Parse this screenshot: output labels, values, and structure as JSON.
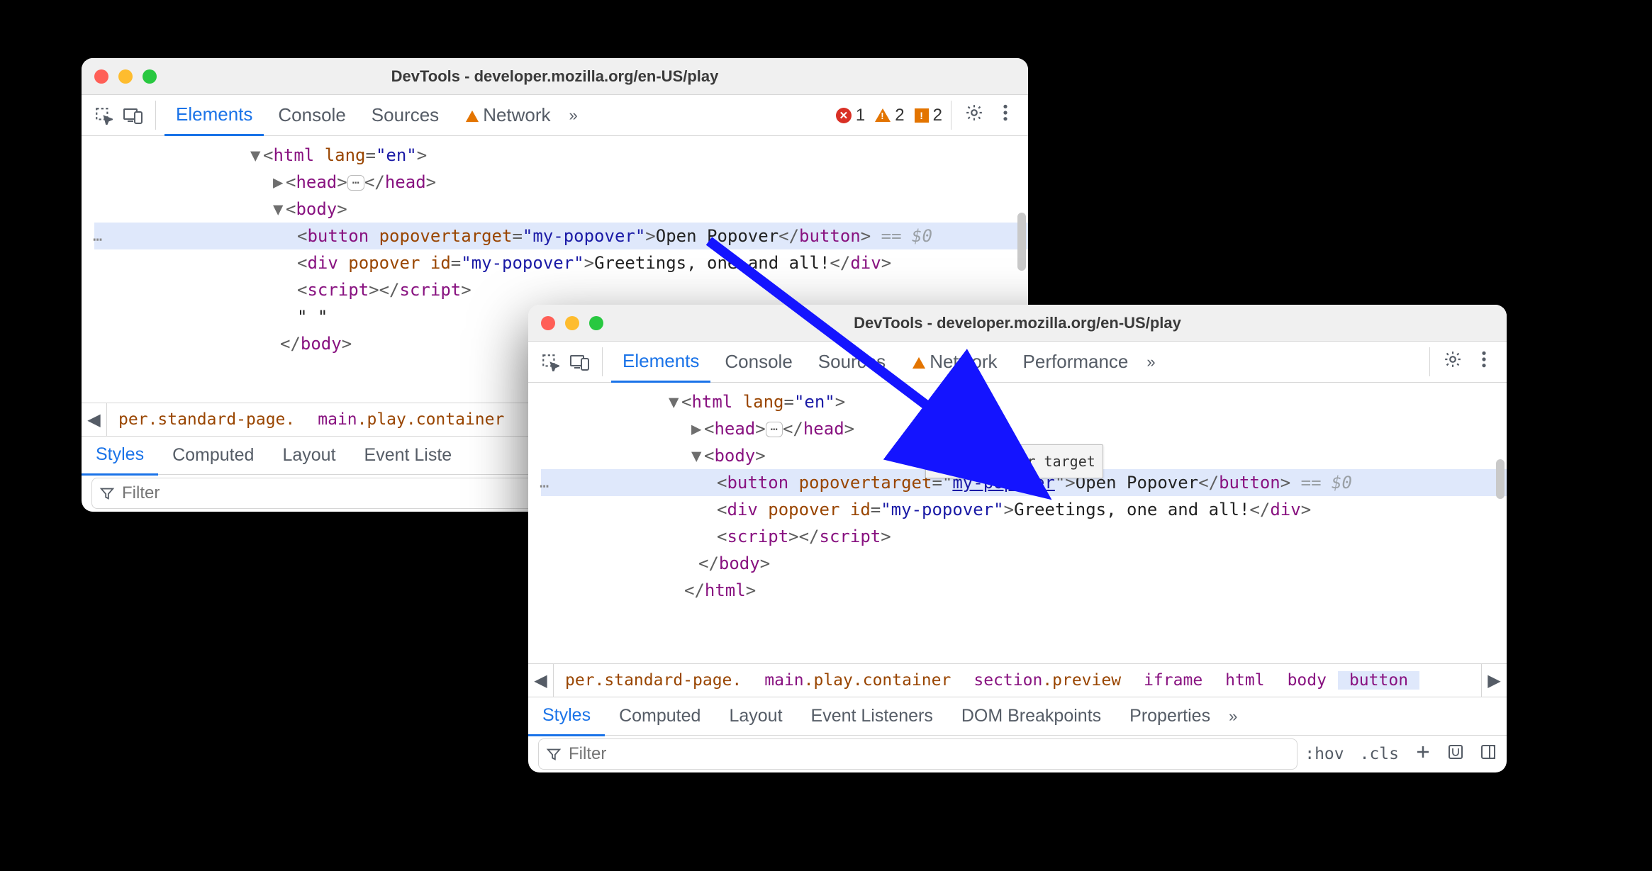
{
  "windowA": {
    "title": "DevTools - developer.mozilla.org/en-US/play",
    "tabs": {
      "elements": "Elements",
      "console": "Console",
      "sources": "Sources",
      "network": "Network"
    },
    "overflow": "»",
    "counts": {
      "error": "1",
      "warning": "2",
      "issue": "2"
    },
    "dom": {
      "html_open": "<html lang=\"en\">",
      "head": "<head>",
      "head_close": "</head>",
      "body_open": "<body>",
      "button_open": "<button popovertarget=",
      "button_val": "\"my-popover\"",
      "button_open2": ">",
      "button_text": "Open Popover",
      "button_close": "</button>",
      "eq": " == $0",
      "div": "<div popover id=\"my-popover\">",
      "div_text": "Greetings, one and all!",
      "div_close": "</div>",
      "script": "<script>",
      "script_close": "</script>",
      "ws": "\" \"",
      "body_close": "</body>"
    },
    "crumbs": {
      "left": "per.standard-page.",
      "right": "main.play.container"
    },
    "subtabs": {
      "styles": "Styles",
      "computed": "Computed",
      "layout": "Layout",
      "event": "Event Liste"
    },
    "filter_placeholder": "Filter"
  },
  "windowB": {
    "title": "DevTools - developer.mozilla.org/en-US/play",
    "tabs": {
      "elements": "Elements",
      "console": "Console",
      "sources": "Sources",
      "network": "Network",
      "performance": "Performance"
    },
    "overflow": "»",
    "dom": {
      "html_open": "<html lang=\"en\">",
      "head": "<head>",
      "head_close": "</head>",
      "body_open": "<body>",
      "button_open": "<button popovertarget=\"",
      "button_val": "my-popover",
      "button_open2": "\">",
      "button_text": "Open Popover",
      "button_close": "</button>",
      "eq": " == $0",
      "div": "<div popover id=\"my-popover\">",
      "div_text": "Greetings, one and all!",
      "div_close": "</div>",
      "script": "<script>",
      "script_close": "</script>",
      "body_close": "</body>",
      "html_close": "</html>"
    },
    "tooltip": "Show popover target",
    "crumbs": [
      "per.standard-page.",
      "main.play.container",
      "section.preview",
      "iframe",
      "html",
      "body",
      "button"
    ],
    "subtabs": {
      "styles": "Styles",
      "computed": "Computed",
      "layout": "Layout",
      "event": "Event Listeners",
      "domb": "DOM Breakpoints",
      "props": "Properties"
    },
    "overflow2": "»",
    "filter_placeholder": "Filter",
    "styles_tools": {
      "hov": ":hov",
      "cls": ".cls"
    }
  }
}
